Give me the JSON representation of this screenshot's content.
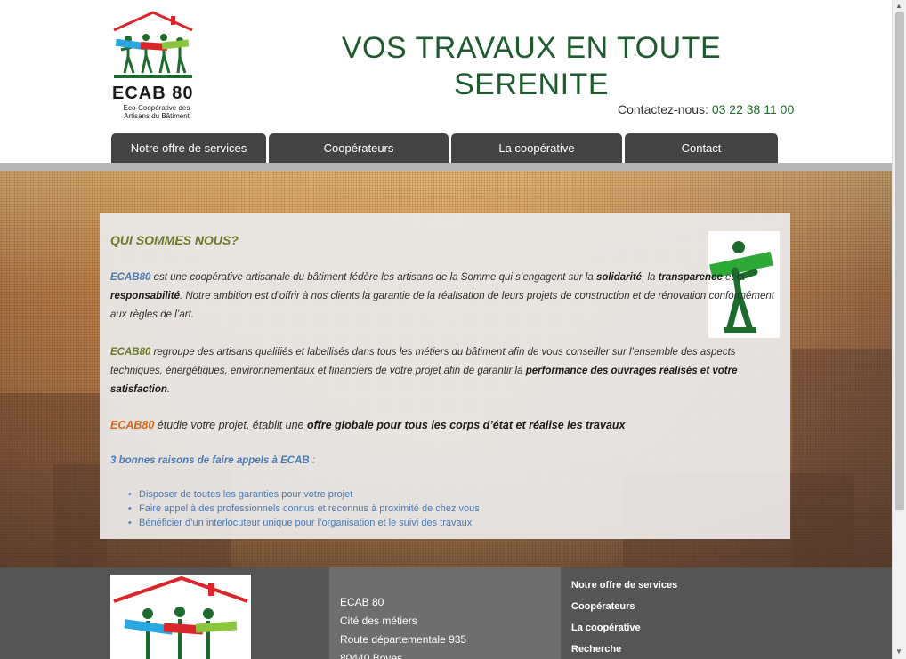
{
  "logo": {
    "title": "ECAB 80",
    "subtitle": "Eco-Coopérative des Artisans du Bâtiment"
  },
  "header": {
    "headline": "VOS TRAVAUX EN TOUTE SERENITE",
    "contact_label": "Contactez-nous:",
    "phone": "03 22 38 11 00"
  },
  "nav": {
    "items": [
      {
        "label": "Notre offre de services"
      },
      {
        "label": "Coopérateurs"
      },
      {
        "label": "La coopérative"
      },
      {
        "label": "Contact"
      }
    ]
  },
  "main": {
    "title": "QUI SOMMES NOUS?",
    "p1": {
      "brand": "ECAB80",
      "t1": " est une coopérative artisanale du bâtiment fédère les artisans de la Somme qui s’engagent sur la ",
      "b1": "solidarité",
      "t2": ", la ",
      "b2": "transparence",
      "t3": " et la ",
      "b3": "responsabilité",
      "t4": ". Notre ambition est d’offrir à nos clients la garantie de la réalisation de leurs projets de construction et de rénovation conformément aux règles de l’art."
    },
    "p2": {
      "brand": "ECAB80",
      "t1": " regroupe des artisans qualifiés et labellisés dans tous les métiers du bâtiment afin de vous conseiller sur l’ensemble des aspects techniques, énergétiques, environnementaux et financiers de votre projet afin de garantir la ",
      "b1": "performance des ouvrages réalisés et votre satisfaction",
      "t2": "."
    },
    "p3": {
      "brand": "ECAB80",
      "t1": " étudie votre projet, établit une ",
      "b1": "offre globale pour tous les corps d’état et réalise les travaux"
    },
    "reasons_title": "3 bonnes raisons de faire appels à ECAB",
    "reasons_suffix": " :",
    "reasons": [
      "Disposer de toutes les garanties pour votre projet",
      "Faire appel à des professionnels connus et reconnus à proximité de chez vous",
      "Bénéficier d’un interlocuteur unique pour l’organisation et le suivi des travaux"
    ]
  },
  "footer": {
    "address": [
      "ECAB 80",
      "Cité des métiers",
      "Route départementale 935",
      "80440 Boves"
    ],
    "links": [
      "Notre offre de services",
      "Coopérateurs",
      "La coopérative",
      "Recherche"
    ]
  },
  "colors": {
    "brand_green": "#1e5b2e",
    "nav": "#444444",
    "footer": "#555555"
  }
}
